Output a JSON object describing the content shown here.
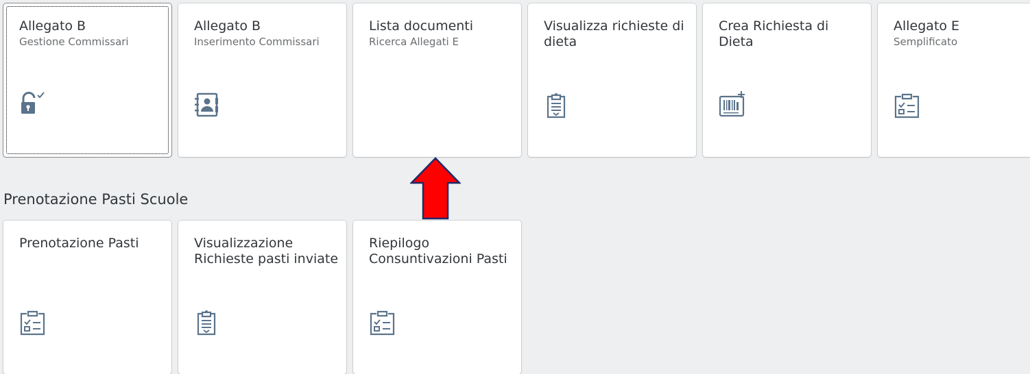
{
  "groups": {
    "top": {
      "tiles": [
        {
          "title": "Allegato B",
          "subtitle": "Gestione Commissari",
          "icon": "unlock-check-icon"
        },
        {
          "title": "Allegato B",
          "subtitle": "Inserimento Commissari",
          "icon": "contacts-book-icon"
        },
        {
          "title": "Lista documenti",
          "subtitle": "Ricerca Allegati E",
          "icon": ""
        },
        {
          "title": "Visualizza richieste di dieta",
          "subtitle": "",
          "icon": "clipboard-list-icon"
        },
        {
          "title": "Crea Richiesta di Dieta",
          "subtitle": "",
          "icon": "barcode-add-icon"
        },
        {
          "title": "Allegato E",
          "subtitle": "Semplificato",
          "icon": "clipboard-checklist-icon"
        }
      ]
    },
    "prenotazione": {
      "title": "Prenotazione Pasti Scuole",
      "tiles": [
        {
          "title": "Prenotazione Pasti",
          "subtitle": "",
          "icon": "clipboard-checklist-icon"
        },
        {
          "title": "Visualizzazione Richieste pasti inviate",
          "subtitle": "",
          "icon": "clipboard-list-icon"
        },
        {
          "title": "Riepilogo Consuntivazioni Pasti",
          "subtitle": "",
          "icon": "clipboard-checklist-icon"
        }
      ]
    }
  },
  "colors": {
    "icon": "#5b738b",
    "background": "#edeff0",
    "arrow_fill": "#ff0000",
    "arrow_stroke": "#1f2a6b"
  }
}
